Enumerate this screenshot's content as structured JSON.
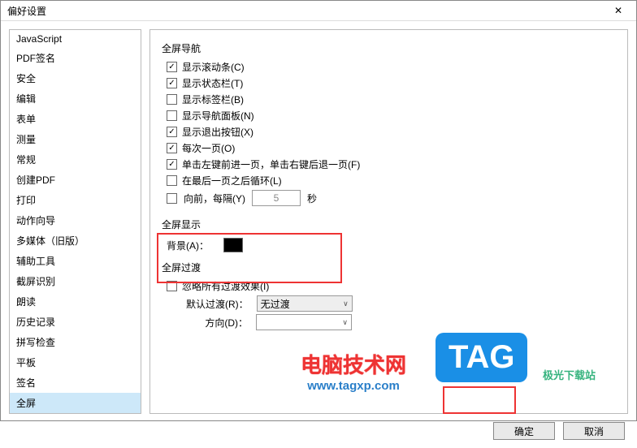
{
  "title": "偏好设置",
  "sidebar": {
    "items": [
      "JavaScript",
      "PDF签名",
      "安全",
      "编辑",
      "表单",
      "测量",
      "常规",
      "创建PDF",
      "打印",
      "动作向导",
      "多媒体（旧版）",
      "辅助工具",
      "截屏识别",
      "朗读",
      "历史记录",
      "拼写检查",
      "平板",
      "签名",
      "全屏"
    ],
    "selected": 18
  },
  "nav": {
    "title": "全屏导航",
    "items": [
      {
        "label": "显示滚动条(C)",
        "checked": true
      },
      {
        "label": "显示状态栏(T)",
        "checked": true
      },
      {
        "label": "显示标签栏(B)",
        "checked": false
      },
      {
        "label": "显示导航面板(N)",
        "checked": false
      },
      {
        "label": "显示退出按钮(X)",
        "checked": true
      },
      {
        "label": "每次一页(O)",
        "checked": true
      },
      {
        "label": "单击左键前进一页，单击右键后退一页(F)",
        "checked": true
      },
      {
        "label": "在最后一页之后循环(L)",
        "checked": false
      }
    ],
    "timer_label": "向前，每隔(Y)",
    "timer_value": "5",
    "timer_unit": "秒"
  },
  "display": {
    "title": "全屏显示",
    "bg_label": "背景(A)：",
    "bg_color": "#000000"
  },
  "transition": {
    "title": "全屏过渡",
    "ignore_label": "忽略所有过渡效果(I)",
    "ignore_checked": false,
    "default_label": "默认过渡(R)：",
    "default_value": "无过渡",
    "direction_label": "方向(D)："
  },
  "buttons": {
    "ok": "确定",
    "cancel": "取消"
  },
  "watermark": {
    "line1": "电脑技术网",
    "line2": "www.tagxp.com",
    "tag": "TAG",
    "jiguang": "极光下载站"
  }
}
